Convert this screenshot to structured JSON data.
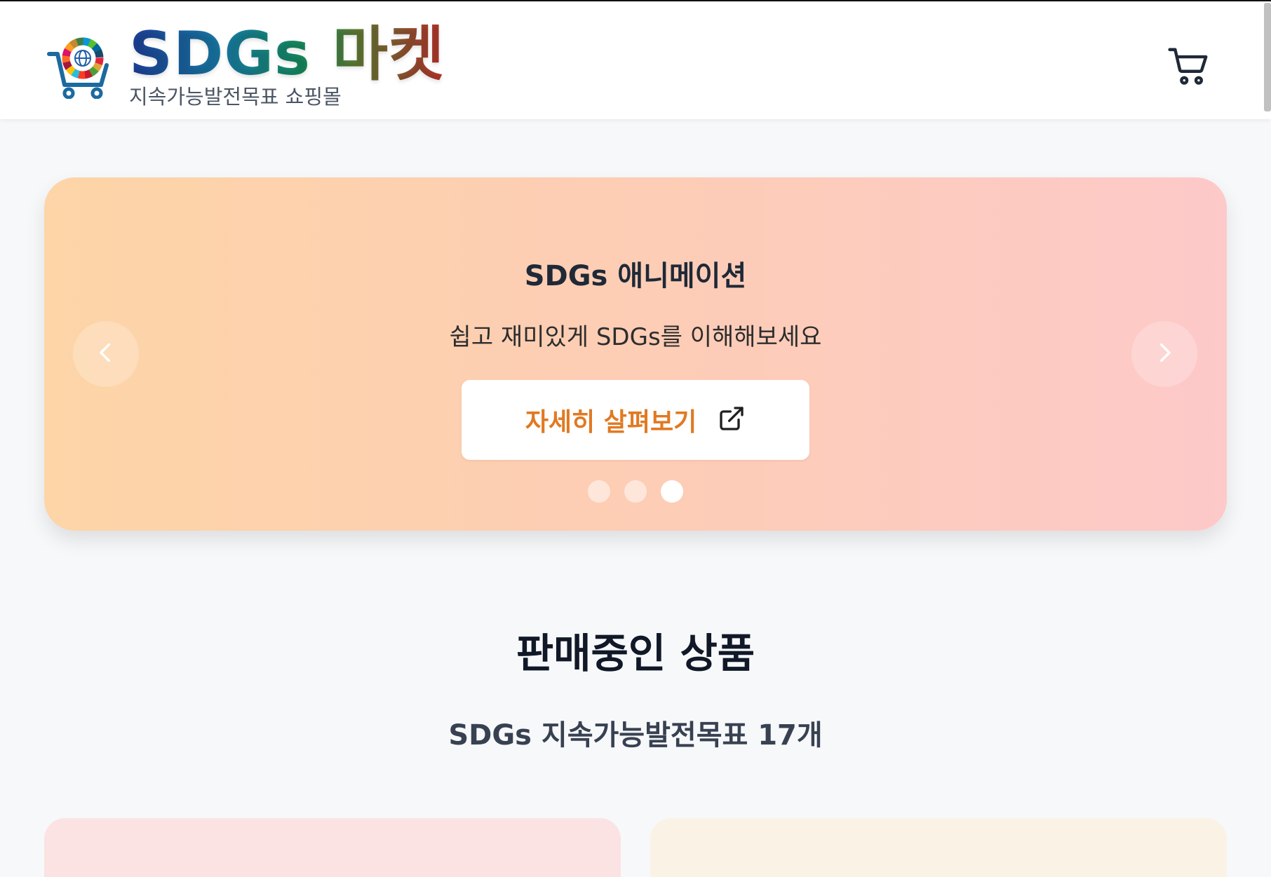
{
  "header": {
    "brand_title": "SDGs 마켓",
    "brand_subtitle": "지속가능발전목표 쇼핑몰",
    "logo_icon": "sdgs-wheel-cart-icon",
    "cart_icon": "shopping-cart-icon"
  },
  "hero": {
    "title": "SDGs 애니메이션",
    "subtitle": "쉽고 재미있게 SDGs를 이해해보세요",
    "cta_label": "자세히 살펴보기",
    "cta_icon": "external-link-icon",
    "prev_icon": "chevron-left-icon",
    "next_icon": "chevron-right-icon",
    "slide_count": 3,
    "active_slide": 3,
    "gradient": [
      "#fdd5a7",
      "#fdc9c9"
    ],
    "cta_color": "#e07a23"
  },
  "products": {
    "title": "판매중인 상품",
    "subtitle": "SDGs 지속가능발전목표 17개",
    "card_colors": [
      "#fbe2e3",
      "#fbf2e6"
    ]
  }
}
